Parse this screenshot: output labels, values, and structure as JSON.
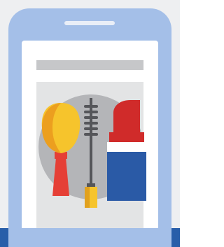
{
  "colors": {
    "page_background": "#eeeff1",
    "phone_frame": "#a4bfe8",
    "speaker": "#e9eef7",
    "screen": "#ffffff",
    "address_bar": "#c6c7c9",
    "content_box": "#e3e4e5",
    "bottom_band": "#285ea9",
    "badge_circle": "#b4b5b8",
    "brush_ferrule": "#e53f36",
    "brush_bristles": "#f6c42c",
    "brush_bristles_shade": "#ec9f1f",
    "mascara_wand": "#55565a",
    "mascara_tube": "#f6c42c",
    "mascara_tube_shade": "#e1a11f",
    "lipstick_color": "#d02b2a",
    "lipstick_band": "#ffffff",
    "lipstick_case": "#2a5aa6"
  },
  "icons": {
    "illustration": "makeup-cosmetics-icon",
    "brush": "makeup-brush-icon",
    "mascara": "mascara-icon",
    "lipstick": "lipstick-icon"
  }
}
